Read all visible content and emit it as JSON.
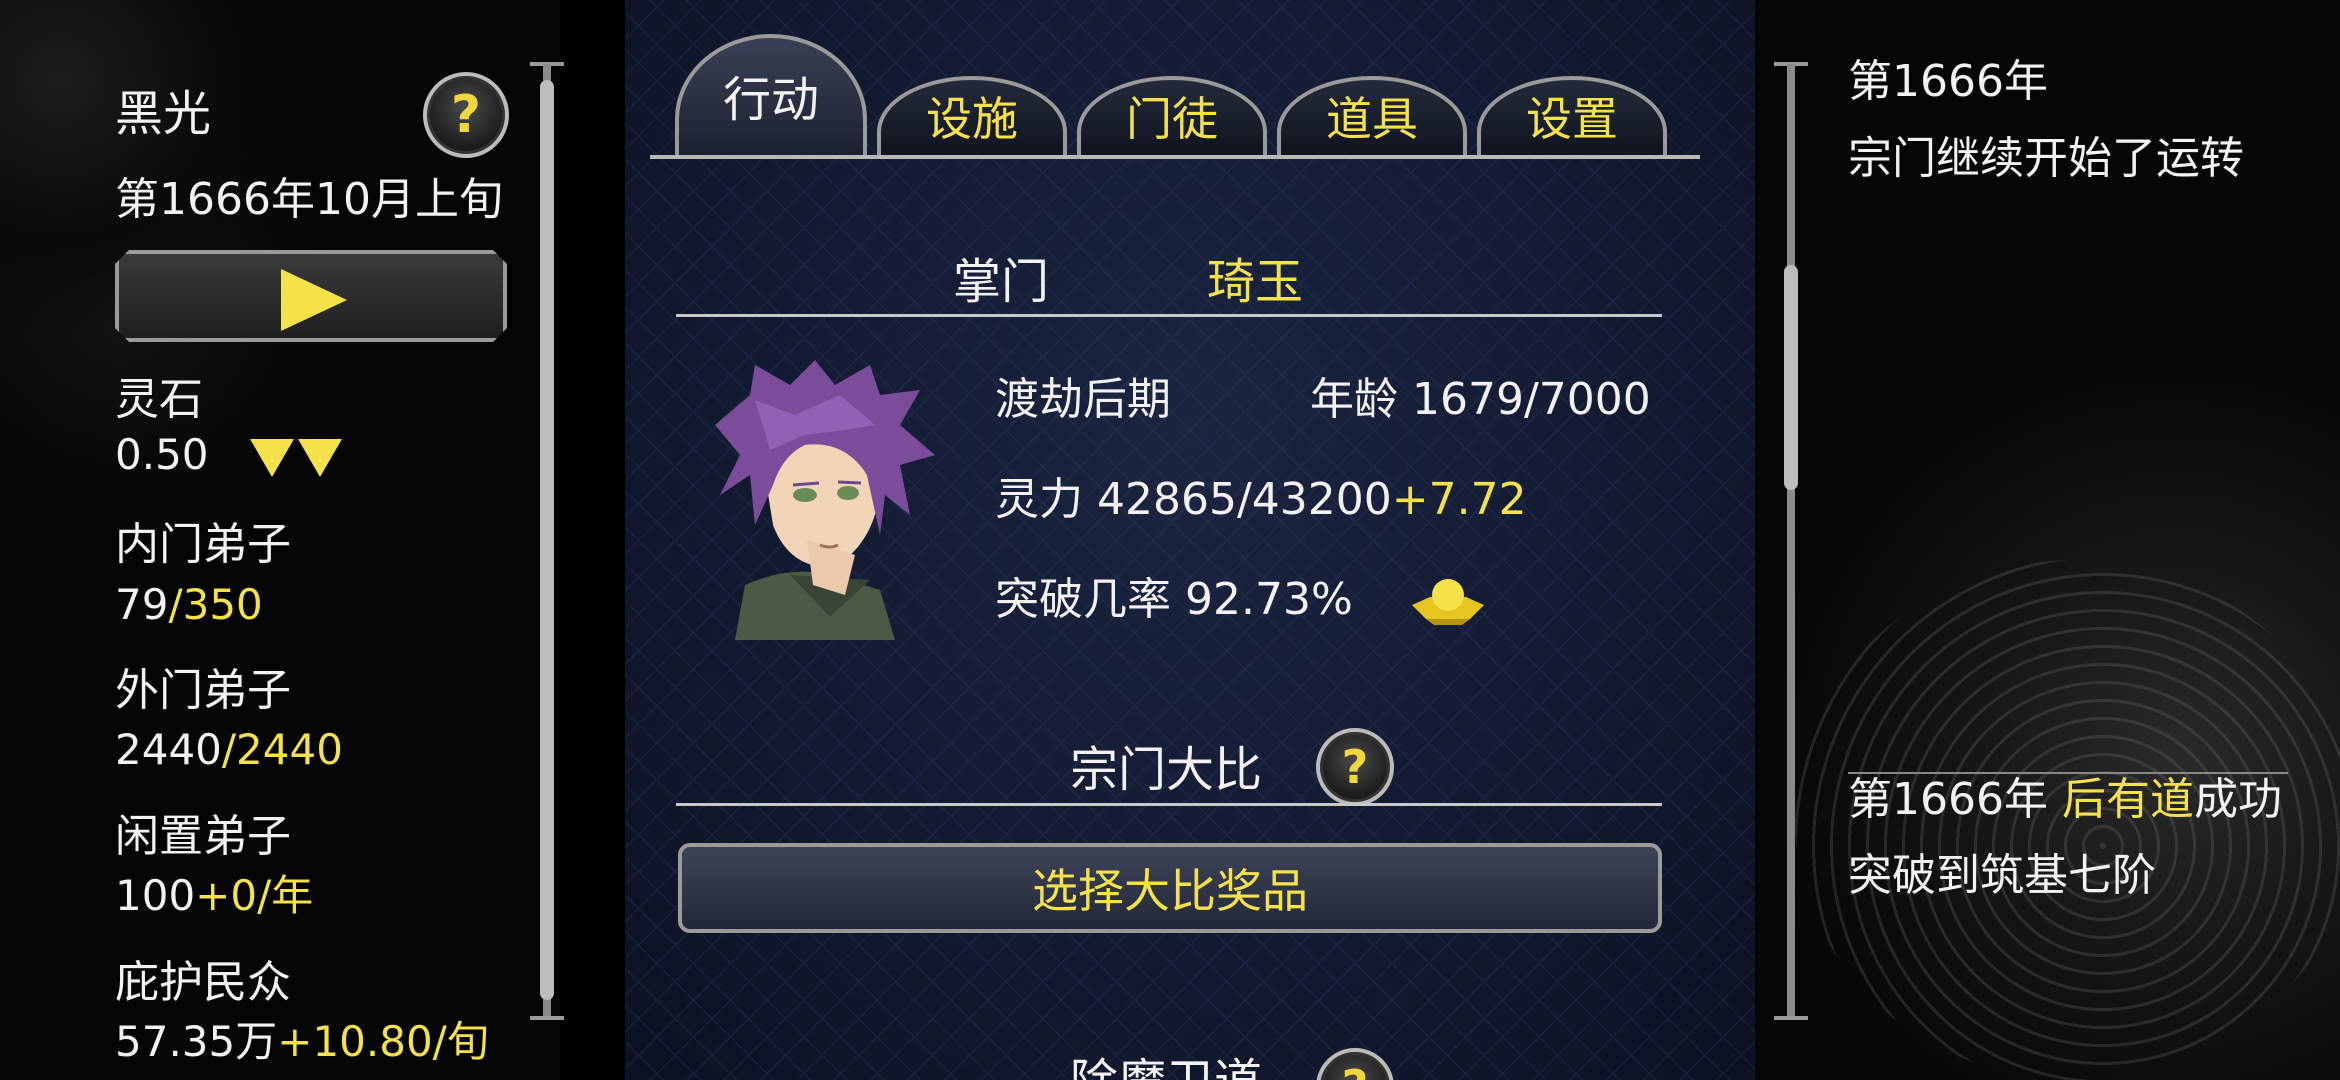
{
  "left_panel": {
    "sect_name": "黑光",
    "date": "第1666年10月上旬",
    "stats": [
      {
        "label": "灵石",
        "value": "0.50",
        "extra": ""
      },
      {
        "label": "内门弟子",
        "value": "79",
        "extra": "/350"
      },
      {
        "label": "外门弟子",
        "value": "2440",
        "extra": "/2440"
      },
      {
        "label": "闲置弟子",
        "value": "100",
        "extra": "+0/年"
      },
      {
        "label": "庇护民众",
        "value": "57.35万",
        "extra": "+10.80/旬"
      }
    ]
  },
  "tabs": [
    {
      "label": "行动",
      "active": true
    },
    {
      "label": "设施",
      "active": false
    },
    {
      "label": "门徒",
      "active": false
    },
    {
      "label": "道具",
      "active": false
    },
    {
      "label": "设置",
      "active": false
    }
  ],
  "leader": {
    "title": "掌门",
    "name": "琦玉",
    "realm": "渡劫后期",
    "age": "年龄 1679/7000",
    "power_label": "灵力 42865/43200",
    "power_delta": "+7.72",
    "breakthrough": "突破几率 92.73%"
  },
  "competition": {
    "title": "宗门大比",
    "button": "选择大比奖品"
  },
  "next_section": {
    "title": "除魔卫道"
  },
  "log": [
    {
      "year": "第1666年",
      "text": "宗门继续开始了运转"
    },
    {
      "year": "第1666年",
      "highlight": "后有道",
      "text": "成功突破到筑基七阶"
    }
  ],
  "icons": {
    "help": "?",
    "play": "play-icon",
    "down": "down-arrow-icon",
    "gold": "gold-ingot-icon"
  },
  "colors": {
    "accent": "#f5e14a",
    "panel": "#141c33"
  }
}
